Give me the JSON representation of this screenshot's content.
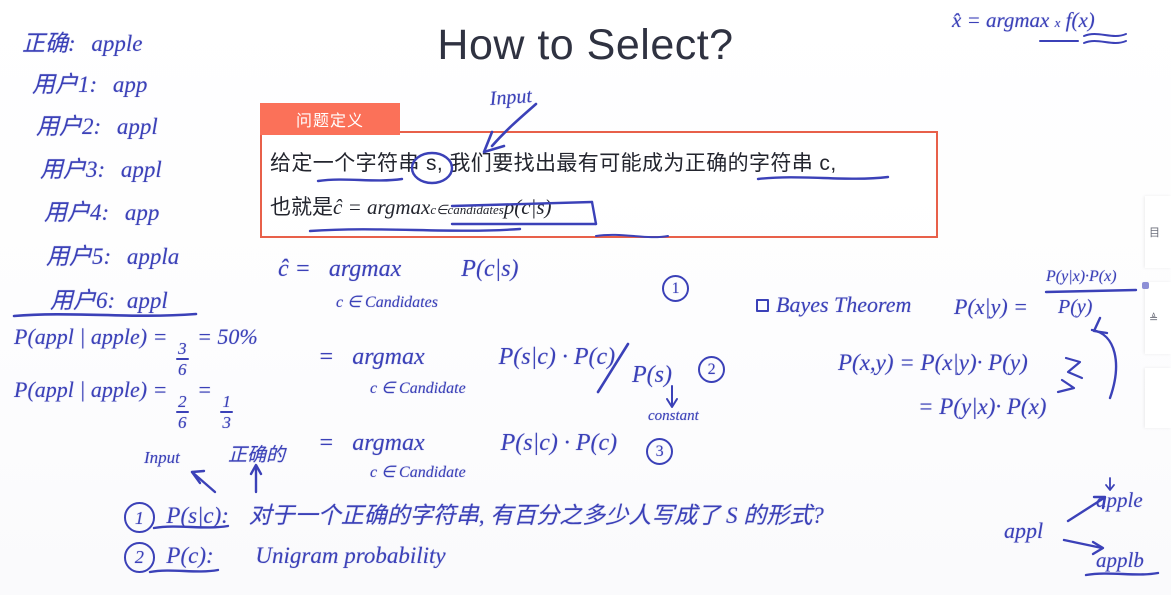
{
  "slide": {
    "title": "How to Select?",
    "definition": {
      "tag_label": "问题定义",
      "line1": "给定一个字符串 s, 我们要找出最有可能成为正确的字符串 c,",
      "line2_prefix": "也就是",
      "line2_formula_head": "ĉ = argmax",
      "line2_formula_sub": "c∈candidates",
      "line2_formula_tail": "p(c|s)",
      "tag_color": "#fb7159",
      "border_color": "#e8604a"
    }
  },
  "annotations": {
    "ink_color": "#3b41b8",
    "top_right_formula": {
      "head": "x̂ = argmax",
      "sub": "x",
      "tail": "f(x)"
    },
    "input_callout": "Input",
    "user_list": [
      {
        "label": "正确:",
        "value": "apple"
      },
      {
        "label": "用户1:",
        "value": "app"
      },
      {
        "label": "用户2:",
        "value": "appl"
      },
      {
        "label": "用户3:",
        "value": "appl"
      },
      {
        "label": "用户4:",
        "value": "app"
      },
      {
        "label": "用户5:",
        "value": "appla"
      },
      {
        "label": "用户6:",
        "value": "appl"
      }
    ],
    "probabilities": [
      {
        "expr": "P(appl | apple) =",
        "num": "3",
        "den": "6",
        "result": "= 50%"
      },
      {
        "expr": "P(appl | apple) =",
        "num": "2",
        "den": "6",
        "result_num": "1",
        "result_den": "3"
      }
    ],
    "derivation": [
      {
        "lhs": "ĉ  =",
        "op": "argmax",
        "cond": "c ∈ Candidates",
        "rhs": "P(c|s)",
        "marker": "1"
      },
      {
        "lhs": "=",
        "op": "argmax",
        "cond": "c ∈ Candidate",
        "rhs": "P(s|c) · P(c)",
        "denominator": "P(s)",
        "marker": "2",
        "note": "constant"
      },
      {
        "lhs": "=",
        "op": "argmax",
        "cond": "c ∈ Candidate",
        "rhs": "P(s|c) · P(c)",
        "marker": "3"
      }
    ],
    "arrow_labels": {
      "input": "Input",
      "correct": "正确的"
    },
    "bayes": {
      "heading": "Bayes Theorem",
      "formula_lhs": "P(x|y) =",
      "formula_num": "P(y|x)·P(x)",
      "formula_den": "P(y)",
      "joint1": "P(x,y) = P(x|y)· P(y)",
      "joint2": "= P(y|x)· P(x)"
    },
    "bottom_notes": [
      {
        "marker": "1",
        "term": "P(s|c):",
        "text": "对于一个正确的字符串, 有百分之多少人写成了 S 的形式?"
      },
      {
        "marker": "2",
        "term": "P(c):",
        "text": "Unigram probability"
      }
    ],
    "candidate_map": {
      "source": "appl",
      "targets": [
        "apple",
        "applb"
      ]
    }
  },
  "edge_panels": [
    {
      "glyph": "目"
    },
    {
      "glyph": "≜"
    },
    {
      "glyph": ""
    }
  ]
}
